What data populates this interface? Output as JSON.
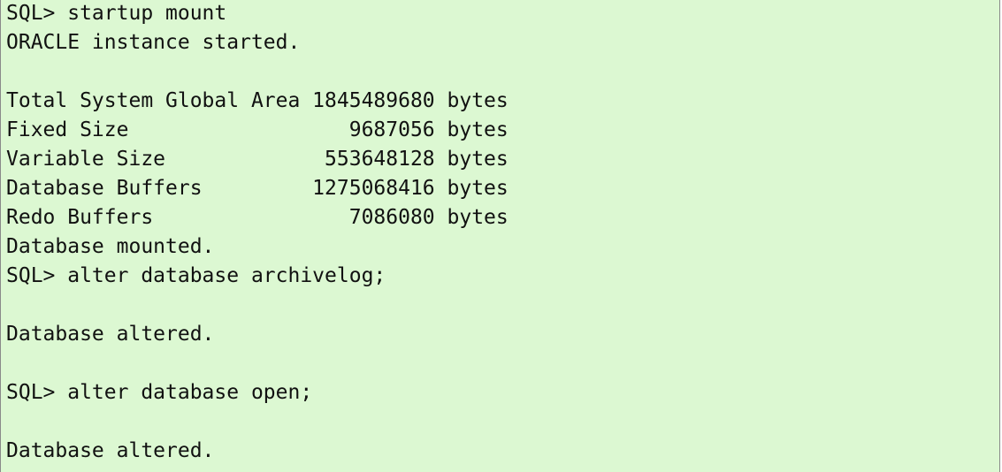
{
  "terminal": {
    "lines": [
      "SQL> startup mount",
      "ORACLE instance started.",
      "",
      "Total System Global Area 1845489680 bytes",
      "Fixed Size                  9687056 bytes",
      "Variable Size             553648128 bytes",
      "Database Buffers         1275068416 bytes",
      "Redo Buffers                7086080 bytes",
      "Database mounted.",
      "SQL> alter database archivelog;",
      "",
      "Database altered.",
      "",
      "SQL> alter database open;",
      "",
      "Database altered."
    ]
  }
}
